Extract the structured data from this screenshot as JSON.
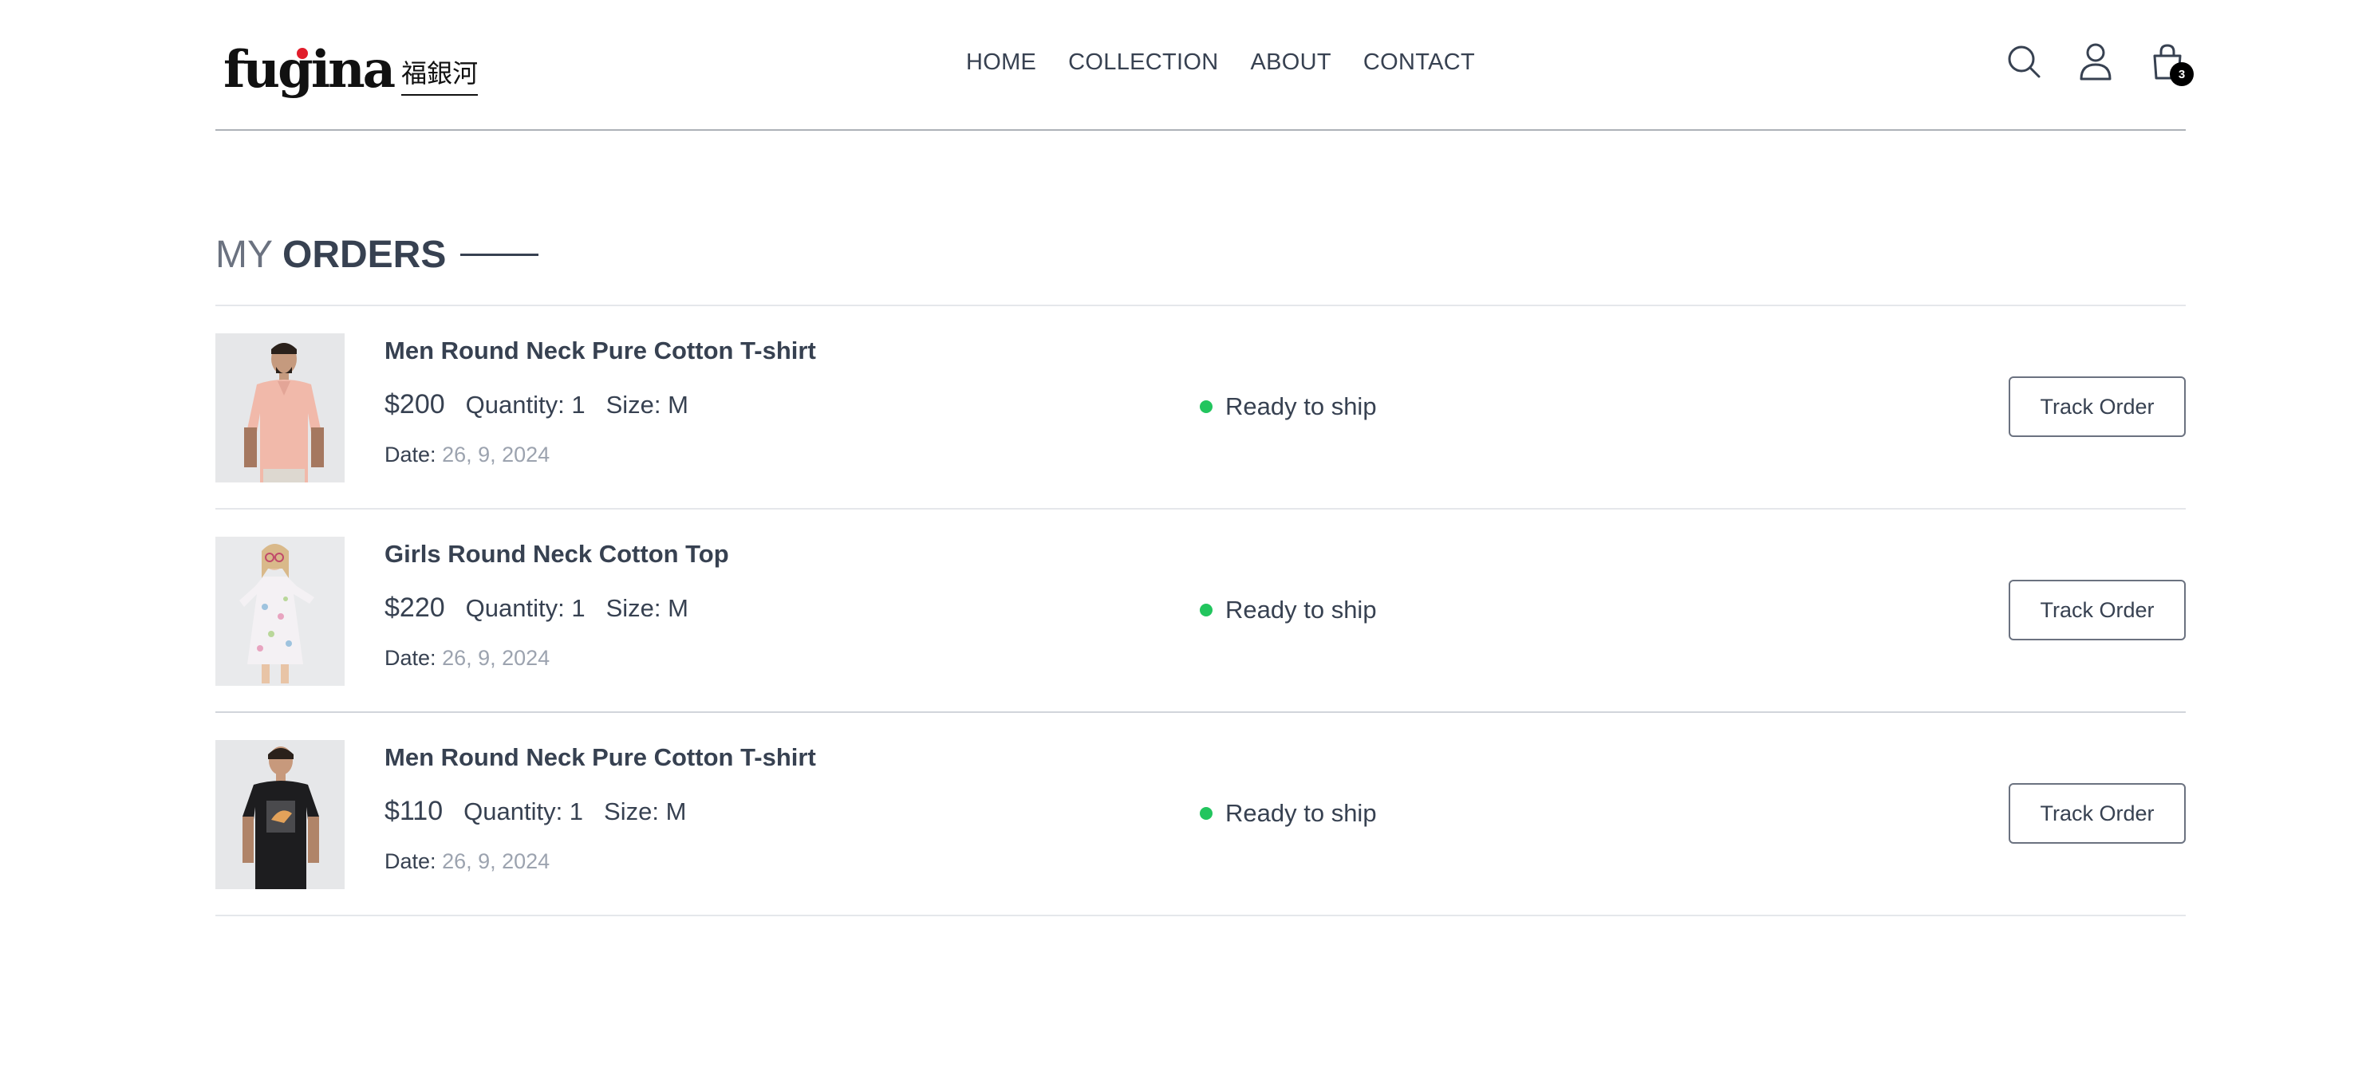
{
  "brand": {
    "logo_text": "fugina",
    "logo_cjk": "福銀河",
    "logo_tagline": "",
    "accent_color": "#e11d2b"
  },
  "nav": {
    "items": [
      "HOME",
      "COLLECTION",
      "ABOUT",
      "CONTACT"
    ]
  },
  "header_icons": {
    "search": "search-icon",
    "profile": "user-icon",
    "cart": "shopping-bag-icon",
    "cart_count": "3"
  },
  "page": {
    "title_light": "MY",
    "title_bold": "ORDERS"
  },
  "orders": [
    {
      "name": "Men Round Neck Pure Cotton T-shirt",
      "price": "$200",
      "quantity_label": "Quantity: 1",
      "size_label": "Size: M",
      "date_label": "Date:",
      "date_value": "26, 9, 2024",
      "status": "Ready to ship",
      "action": "Track Order",
      "image": "man-pink-polo-shirt"
    },
    {
      "name": "Girls Round Neck Cotton Top",
      "price": "$220",
      "quantity_label": "Quantity: 1",
      "size_label": "Size: M",
      "date_label": "Date:",
      "date_value": "26, 9, 2024",
      "status": "Ready to ship",
      "action": "Track Order",
      "image": "girl-floral-dress"
    },
    {
      "name": "Men Round Neck Pure Cotton T-shirt",
      "price": "$110",
      "quantity_label": "Quantity: 1",
      "size_label": "Size: M",
      "date_label": "Date:",
      "date_value": "26, 9, 2024",
      "status": "Ready to ship",
      "action": "Track Order",
      "image": "man-black-graphic-tshirt"
    }
  ],
  "colors": {
    "status_green": "#22c55e",
    "text": "#374151",
    "muted": "#9ca3af"
  }
}
